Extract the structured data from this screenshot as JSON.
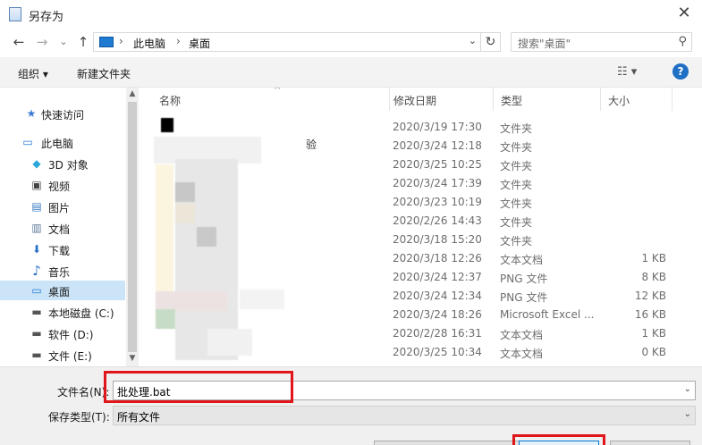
{
  "window": {
    "title": "另存为",
    "close_glyph": "✕"
  },
  "nav": {
    "back": "←",
    "forward": "→",
    "history": "⌄",
    "up": "↑",
    "breadcrumb": [
      "此电脑",
      "桌面"
    ],
    "crumb_sep": "›",
    "refresh": "↻",
    "search_placeholder": "搜索\"桌面\"",
    "search_glyph": "⚲",
    "dropdown": "⌄"
  },
  "toolbar": {
    "organize": "组织 ▾",
    "new_folder": "新建文件夹",
    "view": "☷ ▾",
    "help": "?"
  },
  "sidebar": {
    "items": [
      {
        "label": "快速访问",
        "icon": "★",
        "color": "#3a7bd5"
      },
      {
        "label": "此电脑",
        "icon": "▭",
        "color": "#1f7ad1"
      },
      {
        "label": "3D 对象",
        "icon": "◆",
        "color": "#2aa6d8"
      },
      {
        "label": "视频",
        "icon": "▣",
        "color": "#444444"
      },
      {
        "label": "图片",
        "icon": "▤",
        "color": "#3b7cc4"
      },
      {
        "label": "文档",
        "icon": "▥",
        "color": "#607d9b"
      },
      {
        "label": "下载",
        "icon": "⬇",
        "color": "#2a6fc9"
      },
      {
        "label": "音乐",
        "icon": "♪",
        "color": "#2a6fc9"
      },
      {
        "label": "桌面",
        "icon": "▭",
        "color": "#1f7ad1"
      },
      {
        "label": "本地磁盘 (C:)",
        "icon": "▬",
        "color": "#555555"
      },
      {
        "label": "软件 (D:)",
        "icon": "▬",
        "color": "#555555"
      },
      {
        "label": "文件 (E:)",
        "icon": "▬",
        "color": "#555555"
      }
    ]
  },
  "columns": {
    "name": "名称",
    "modified": "修改日期",
    "type": "类型",
    "size": "大小",
    "sort_glyph": "^"
  },
  "files": [
    {
      "date": "2020/3/19 17:30",
      "type": "文件夹",
      "size": ""
    },
    {
      "date": "2020/3/24 12:18",
      "type": "文件夹",
      "size": ""
    },
    {
      "date": "2020/3/25 10:25",
      "type": "文件夹",
      "size": ""
    },
    {
      "date": "2020/3/24 17:39",
      "type": "文件夹",
      "size": ""
    },
    {
      "date": "2020/3/23 10:19",
      "type": "文件夹",
      "size": ""
    },
    {
      "date": "2020/2/26 14:43",
      "type": "文件夹",
      "size": ""
    },
    {
      "date": "2020/3/18 15:20",
      "type": "文件夹",
      "size": ""
    },
    {
      "date": "2020/3/18 12:26",
      "type": "文本文档",
      "size": "1 KB"
    },
    {
      "date": "2020/3/24 12:37",
      "type": "PNG 文件",
      "size": "8 KB"
    },
    {
      "date": "2020/3/24 12:34",
      "type": "PNG 文件",
      "size": "12 KB"
    },
    {
      "date": "2020/3/24 18:26",
      "type": "Microsoft Excel ...",
      "size": "16 KB"
    },
    {
      "date": "2020/2/28 16:31",
      "type": "文本文档",
      "size": "1 KB"
    },
    {
      "date": "2020/3/25 10:34",
      "type": "文本文档",
      "size": "0 KB"
    }
  ],
  "partial_name": "验",
  "form": {
    "filename_label": "文件名(N):",
    "filename_value": "批处理.bat",
    "filetype_label": "保存类型(T):",
    "filetype_value": "所有文件",
    "dropdown": "⌄"
  },
  "colors": {
    "selection": "#cce4f7",
    "highlight": "#e0161b",
    "accent": "#1f6fc5"
  }
}
